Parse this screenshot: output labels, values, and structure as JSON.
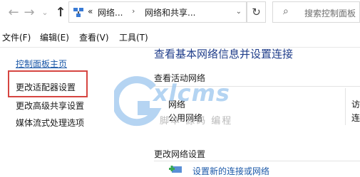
{
  "nav": {
    "back_icon": "arrow-left-icon",
    "forward_icon": "arrow-right-icon",
    "recent_icon": "chevron-down-icon",
    "up_icon": "arrow-up-icon"
  },
  "address": {
    "overflow": "«",
    "crumbs": [
      "网络...",
      "网络和共享..."
    ],
    "dropdown_icon": "chevron-down-icon"
  },
  "search": {
    "placeholder": "搜索控制面板",
    "icon": "search-icon"
  },
  "menu": [
    "文件(F)",
    "编辑(E)",
    "查看(V)",
    "工具(T)"
  ],
  "sidebar": {
    "home": "控制面板主页",
    "items": [
      "更改适配器设置",
      "更改高级共享设置",
      "媒体流式处理选项"
    ]
  },
  "main": {
    "title": "查看基本网络信息并设置连接",
    "active_header": "查看活动网络",
    "network_name": "网络",
    "network_type": "公用网络",
    "right_col": [
      "访",
      "连"
    ],
    "change_header": "更改网络设置",
    "setup_link": "设置新的连接或网络"
  },
  "watermark": {
    "text": "xlcms",
    "sub": "脚本 源码 编程"
  },
  "colors": {
    "link": "#1b58a8",
    "title": "#1f3d8a",
    "highlight": "#d64541",
    "watermark": "#9cc6ee"
  }
}
